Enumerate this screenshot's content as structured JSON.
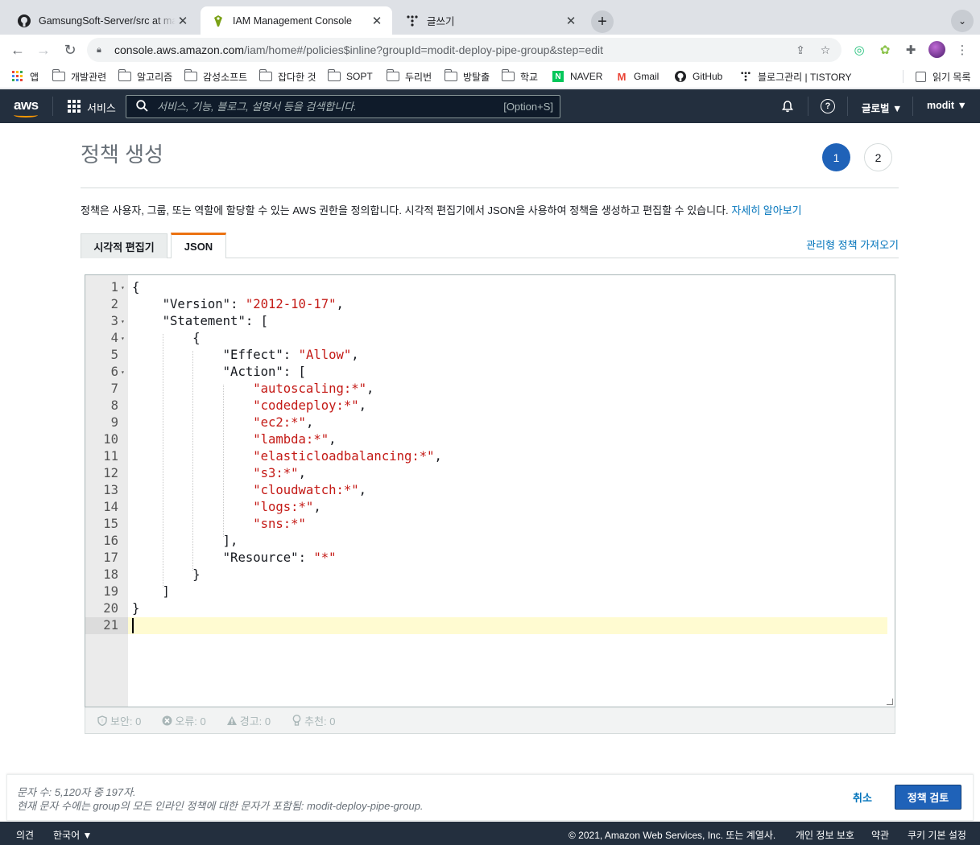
{
  "browser": {
    "tabs": [
      {
        "title": "GamsungSoft-Server/src at ma",
        "icon": "github-icon"
      },
      {
        "title": "IAM Management Console",
        "icon": "aws-iam-icon"
      },
      {
        "title": "글쓰기",
        "icon": "tistory-icon"
      }
    ],
    "url_host": "console.aws.amazon.com",
    "url_path": "/iam/home#/policies$inline?groupId=modit-deploy-pipe-group&step=edit",
    "bookmarks": [
      "앱",
      "개발관련",
      "알고리즘",
      "감성소프트",
      "잡다한 것",
      "SOPT",
      "두리번",
      "방탈출",
      "학교",
      "NAVER",
      "Gmail",
      "GitHub",
      "블로그관리 | TISTORY"
    ],
    "reading_list": "읽기 목록"
  },
  "aws": {
    "logo": "aws",
    "services": "서비스",
    "search_placeholder": "서비스, 기능, 블로그, 설명서 등을 검색합니다.",
    "search_shortcut": "[Option+S]",
    "region": "글로벌 ▼",
    "account": "modit ▼"
  },
  "page": {
    "title": "정책 생성",
    "steps": [
      "1",
      "2"
    ],
    "description": "정책은 사용자, 그룹, 또는 역할에 할당할 수 있는 AWS 권한을 정의합니다. 시각적 편집기에서 JSON을 사용하여 정책을 생성하고 편집할 수 있습니다.",
    "learn_more": "자세히 알아보기",
    "tab_visual": "시각적 편집기",
    "tab_json": "JSON",
    "import_managed": "관리형 정책 가져오기"
  },
  "editor": {
    "lines": [
      "{",
      "    \"Version\": \"2012-10-17\",",
      "    \"Statement\": [",
      "        {",
      "            \"Effect\": \"Allow\",",
      "            \"Action\": [",
      "                \"autoscaling:*\",",
      "                \"codedeploy:*\",",
      "                \"ec2:*\",",
      "                \"lambda:*\",",
      "                \"elasticloadbalancing:*\",",
      "                \"s3:*\",",
      "                \"cloudwatch:*\",",
      "                \"logs:*\",",
      "                \"sns:*\"",
      "            ],",
      "            \"Resource\": \"*\"",
      "        }",
      "    ]",
      "}",
      ""
    ],
    "fold_lines": [
      1,
      3,
      4,
      6
    ],
    "active_line": 21
  },
  "validation": {
    "security": "보안: 0",
    "errors": "오류: 0",
    "warnings": "경고: 0",
    "suggestions": "추천: 0"
  },
  "actions": {
    "char_count": "문자 수: 5,120자 중 197자.",
    "char_note": "현재 문자 수에는 group의 모든 인라인 정책에 대한 문자가 포함됨: modit-deploy-pipe-group.",
    "cancel": "취소",
    "review": "정책 검토"
  },
  "footer": {
    "feedback": "의견",
    "language": "한국어 ▼",
    "copyright": "© 2021, Amazon Web Services, Inc. 또는 계열사.",
    "privacy": "개인 정보 보호",
    "terms": "약관",
    "cookies": "쿠키 기본 설정"
  },
  "colors": {
    "aws_nav": "#232f3e",
    "aws_orange": "#ff9900",
    "primary": "#1f62b8",
    "link": "#0073bb",
    "json_string": "#c41a16"
  }
}
